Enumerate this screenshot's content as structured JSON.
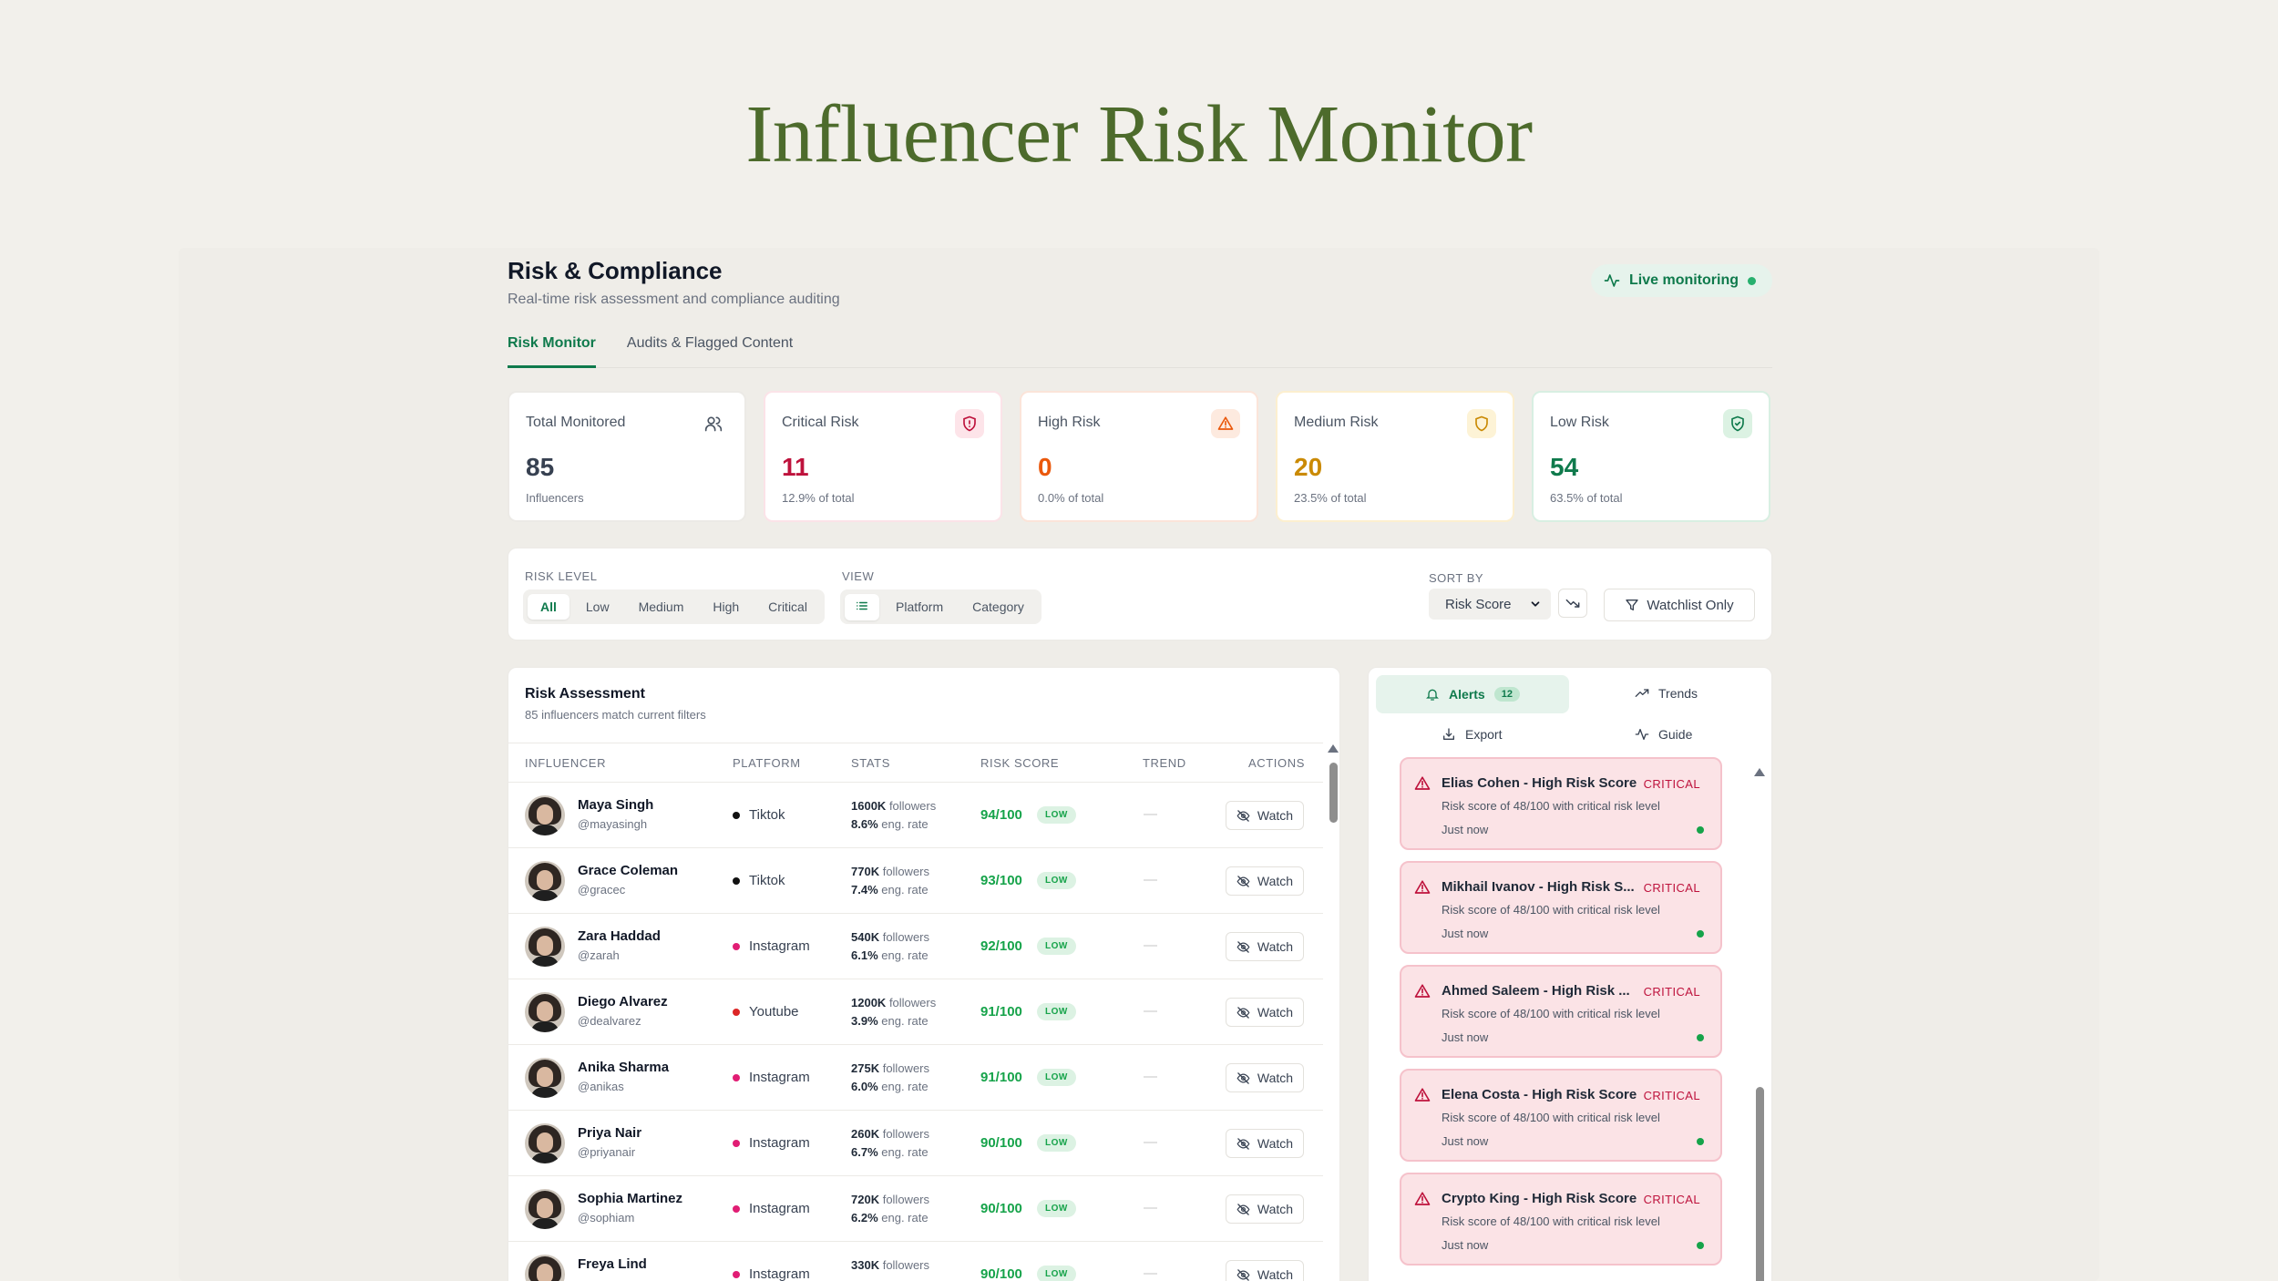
{
  "page_title": "Influencer Risk Monitor",
  "header": {
    "title": "Risk & Compliance",
    "subtitle": "Real-time risk assessment and compliance auditing",
    "live_label": "Live monitoring"
  },
  "tabs": [
    {
      "label": "Risk Monitor",
      "active": true
    },
    {
      "label": "Audits & Flagged Content",
      "active": false
    }
  ],
  "stats": [
    {
      "label": "Total Monitored",
      "value": "85",
      "foot": "Influencers",
      "icon": "users-icon",
      "color": "#374151"
    },
    {
      "label": "Critical Risk",
      "value": "11",
      "foot": "12.9% of total",
      "icon": "shield-alert-icon",
      "color": "#be123c"
    },
    {
      "label": "High Risk",
      "value": "0",
      "foot": "0.0% of total",
      "icon": "warning-triangle-icon",
      "color": "#ea580c"
    },
    {
      "label": "Medium Risk",
      "value": "20",
      "foot": "23.5% of total",
      "icon": "shield-icon",
      "color": "#ca8a04"
    },
    {
      "label": "Low Risk",
      "value": "54",
      "foot": "63.5% of total",
      "icon": "shield-check-icon",
      "color": "#0f7a4c"
    }
  ],
  "filters": {
    "risk_level_label": "RISK LEVEL",
    "risk_levels": [
      "All",
      "Low",
      "Medium",
      "High",
      "Critical"
    ],
    "view_label": "VIEW",
    "views": [
      "Platform",
      "Category"
    ],
    "sort_label": "SORT BY",
    "sort_value": "Risk Score",
    "watchlist_label": "Watchlist Only"
  },
  "table": {
    "title": "Risk Assessment",
    "subtitle": "85 influencers match current filters",
    "columns": [
      "INFLUENCER",
      "PLATFORM",
      "STATS",
      "RISK SCORE",
      "TREND",
      "ACTIONS"
    ],
    "followers_suffix": "followers",
    "eng_suffix": "eng. rate",
    "trend_placeholder": "—",
    "watch_label": "Watch",
    "rows": [
      {
        "name": "Maya Singh",
        "handle": "@mayasingh",
        "platform": "Tiktok",
        "platform_color": "#111111",
        "followers": "1600K",
        "eng": "8.6%",
        "score": "94/100",
        "badge": "LOW"
      },
      {
        "name": "Grace Coleman",
        "handle": "@gracec",
        "platform": "Tiktok",
        "platform_color": "#111111",
        "followers": "770K",
        "eng": "7.4%",
        "score": "93/100",
        "badge": "LOW"
      },
      {
        "name": "Zara Haddad",
        "handle": "@zarah",
        "platform": "Instagram",
        "platform_color": "#e11d74",
        "followers": "540K",
        "eng": "6.1%",
        "score": "92/100",
        "badge": "LOW"
      },
      {
        "name": "Diego Alvarez",
        "handle": "@dealvarez",
        "platform": "Youtube",
        "platform_color": "#dc2626",
        "followers": "1200K",
        "eng": "3.9%",
        "score": "91/100",
        "badge": "LOW"
      },
      {
        "name": "Anika Sharma",
        "handle": "@anikas",
        "platform": "Instagram",
        "platform_color": "#e11d74",
        "followers": "275K",
        "eng": "6.0%",
        "score": "91/100",
        "badge": "LOW"
      },
      {
        "name": "Priya Nair",
        "handle": "@priyanair",
        "platform": "Instagram",
        "platform_color": "#e11d74",
        "followers": "260K",
        "eng": "6.7%",
        "score": "90/100",
        "badge": "LOW"
      },
      {
        "name": "Sophia Martinez",
        "handle": "@sophiam",
        "platform": "Instagram",
        "platform_color": "#e11d74",
        "followers": "720K",
        "eng": "6.2%",
        "score": "90/100",
        "badge": "LOW"
      },
      {
        "name": "Freya Lind",
        "handle": "",
        "platform": "Instagram",
        "platform_color": "#e11d74",
        "followers": "330K",
        "eng": "",
        "score": "90/100",
        "badge": "LOW"
      }
    ]
  },
  "side": {
    "tabs": {
      "alerts": "Alerts",
      "alerts_count": "12",
      "trends": "Trends",
      "export": "Export",
      "guide": "Guide"
    },
    "critical_label": "CRITICAL",
    "alerts": [
      {
        "title": "Elias Cohen - High Risk Score",
        "desc": "Risk score of 48/100 with critical risk level",
        "time": "Just now"
      },
      {
        "title": "Mikhail Ivanov - High Risk S...",
        "desc": "Risk score of 48/100 with critical risk level",
        "time": "Just now"
      },
      {
        "title": "Ahmed Saleem - High Risk ...",
        "desc": "Risk score of 48/100 with critical risk level",
        "time": "Just now"
      },
      {
        "title": "Elena Costa - High Risk Score",
        "desc": "Risk score of 48/100 with critical risk level",
        "time": "Just now"
      },
      {
        "title": "Crypto King - High Risk Score",
        "desc": "Risk score of 48/100 with critical risk level",
        "time": "Just now"
      }
    ]
  }
}
